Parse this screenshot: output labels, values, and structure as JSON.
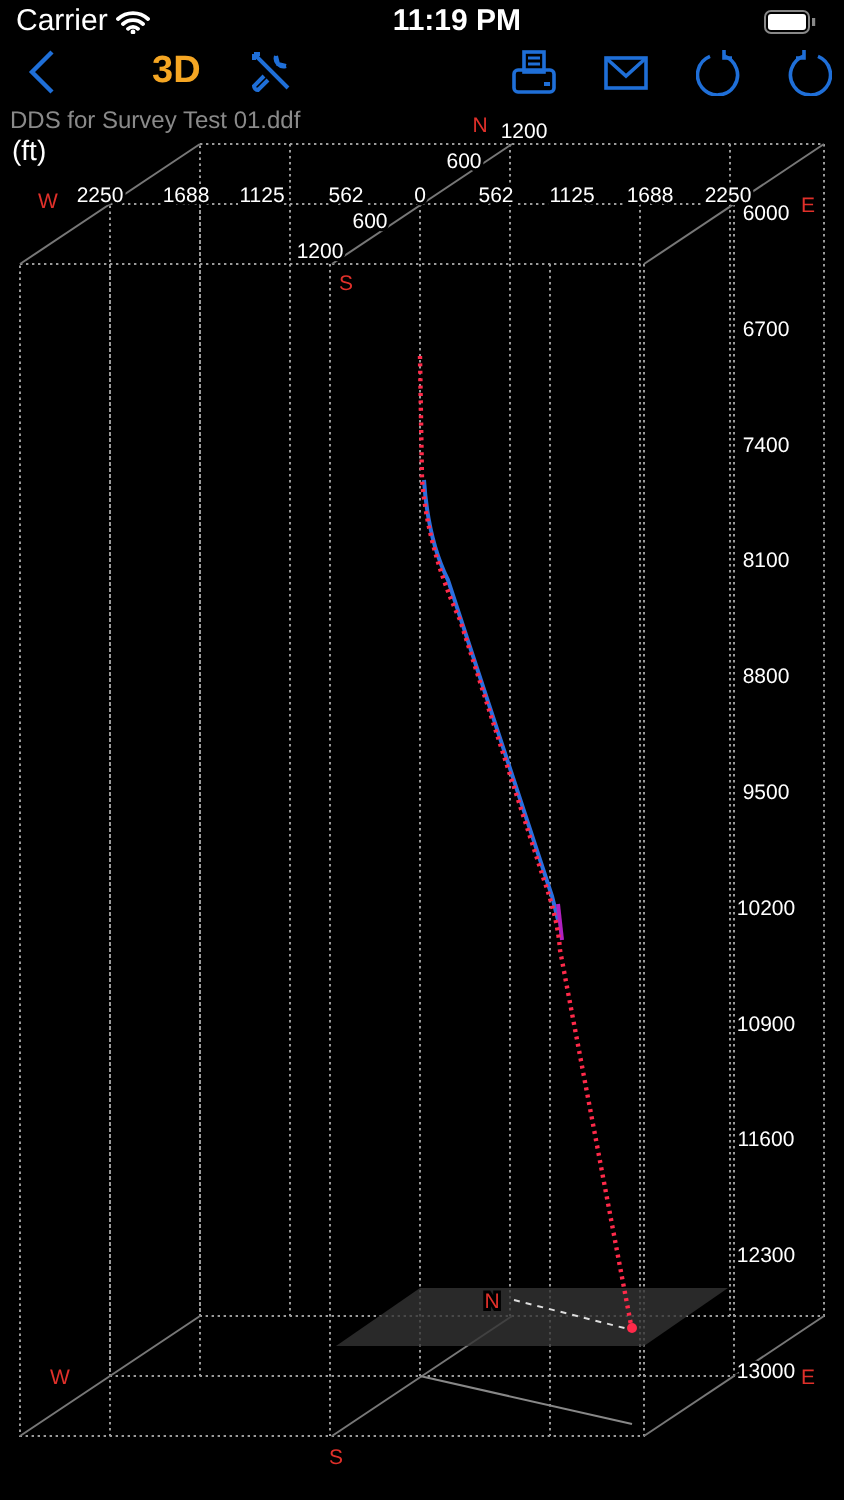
{
  "status_bar": {
    "carrier": "Carrier",
    "time": "11:19 PM"
  },
  "toolbar": {
    "mode_label": "3D"
  },
  "file_name": "DDS for Survey Test 01.ddf",
  "unit": "(ft)",
  "plot": {
    "ew_ticks": [
      "2250",
      "1688",
      "1125",
      "562",
      "0",
      "562",
      "1125",
      "1688",
      "2250"
    ],
    "ns_ticks": [
      "1200",
      "600",
      "600",
      "1200"
    ],
    "depth_ticks": [
      "6000",
      "6700",
      "7400",
      "8100",
      "8800",
      "9500",
      "10200",
      "10900",
      "11600",
      "12300",
      "13000"
    ],
    "compass": [
      "N",
      "W",
      "E",
      "S",
      "N",
      "W",
      "E",
      "S"
    ]
  }
}
